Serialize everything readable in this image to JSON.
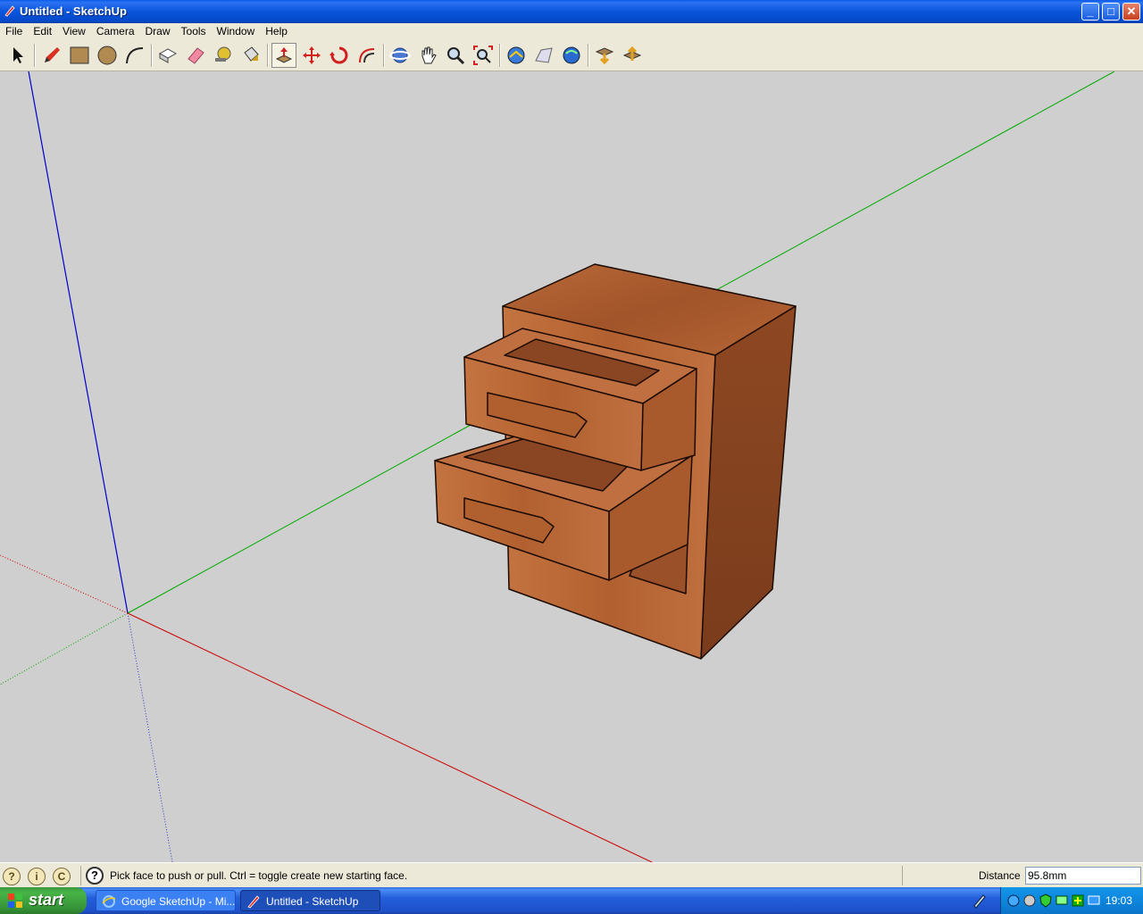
{
  "window": {
    "title": "Untitled - SketchUp",
    "buttons": {
      "minimize": "_",
      "maximize": "□",
      "close": "✕"
    }
  },
  "menu": [
    "File",
    "Edit",
    "View",
    "Camera",
    "Draw",
    "Tools",
    "Window",
    "Help"
  ],
  "toolbar": {
    "tools": [
      "select-icon",
      "pencil-icon",
      "rectangle-icon",
      "circle-icon",
      "arc-icon",
      "make-component-icon",
      "eraser-icon",
      "tape-measure-icon",
      "paint-bucket-icon",
      "push-pull-icon",
      "move-icon",
      "rotate-icon",
      "offset-icon",
      "orbit-icon",
      "pan-icon",
      "zoom-icon",
      "zoom-extents-icon",
      "get-current-view-icon",
      "toggle-terrain-icon",
      "place-model-icon",
      "get-models-icon",
      "share-model-icon"
    ]
  },
  "status": {
    "message": "Pick face to push or pull.  Ctrl = toggle create new starting face.",
    "distance_label": "Distance",
    "distance_value": "95.8mm"
  },
  "taskbar": {
    "start_label": "start",
    "tasks": [
      "Google SketchUp - Mi...",
      "Untitled - SketchUp"
    ],
    "clock": "19:03"
  },
  "colors": {
    "viewport_bg": "#cfcfcf",
    "axis_red": "#cc0000",
    "axis_green": "#00aa00",
    "axis_blue": "#0000cc",
    "wood": "#a85a2c"
  }
}
